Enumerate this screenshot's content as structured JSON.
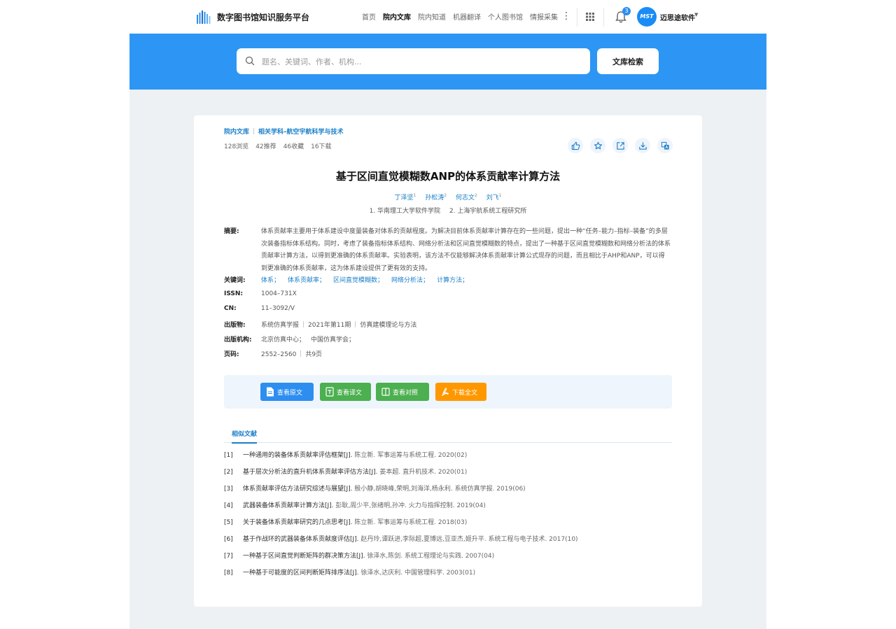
{
  "header": {
    "logo_text": "数字图书馆知识服务平台",
    "nav": [
      "首页",
      "院内文库",
      "院内知道",
      "机器翻译",
      "个人图书馆",
      "情报采集"
    ],
    "active_nav": "院内文库",
    "notification_count": "3",
    "avatar_text": "MST",
    "user_name": "迈思途软件"
  },
  "search": {
    "placeholder": "题名、关键词、作者、机构...",
    "button_label": "文库检索"
  },
  "breadcrumb": [
    "院内文库",
    "相关学科–航空宇航科学与技术"
  ],
  "stats": [
    "128浏览",
    "42推荐",
    "46收藏",
    "16下载"
  ],
  "actions": [
    "like-icon",
    "star-icon",
    "share-icon",
    "download-icon",
    "translate-icon"
  ],
  "article": {
    "title": "基于区间直觉模糊数ANP的体系贡献率计算方法",
    "authors": [
      {
        "name": "丁泽坚",
        "sup": "1"
      },
      {
        "name": "孙松涛",
        "sup": "2"
      },
      {
        "name": "何志文",
        "sup": "2"
      },
      {
        "name": "刘飞",
        "sup": "1"
      }
    ],
    "affiliations": [
      "1. 华南理工大学软件学院",
      "2. 上海宇航系统工程研究所"
    ]
  },
  "meta": {
    "abstract_label": "摘要:",
    "abstract": "体系贡献率主要用于体系建设中度量装备对体系的贡献程度。为解决目前体系贡献率计算存在的一些问题，提出一种“任务–能力–指标–装备”的多层次装备指标体系结构。同时，考虑了装备指标体系结构、网络分析法和区间直觉模糊数的特点，提出了一种基于区间直觉模糊数和网络分析法的体系贡献率计算方法，以得到更准确的体系贡献率。实验表明，该方法不仅能够解决体系贡献率计算公式现存的问题，而且相比于AHP和ANP，可以得到更准确的体系贡献率，这为体系建设提供了更有效的支持。",
    "keywords_label": "关键词:",
    "keywords": [
      "体系；",
      "体系贡献率；",
      "区间直觉模糊数；",
      "网络分析法；",
      "计算方法；"
    ],
    "issn_label": "ISSN:",
    "issn": "1004–731X",
    "cn_label": "CN:",
    "cn": "11–3092/V",
    "publication_label": "出版物:",
    "publication": [
      "系统仿真学报",
      "2021年第11期",
      "仿真建模理论与方法"
    ],
    "publisher_label": "出版机构:",
    "publishers": [
      "北京仿真中心；",
      "中国仿真学会；"
    ],
    "pages_label": "页码:",
    "pages": [
      "2552–2560",
      "共9页"
    ]
  },
  "buttons": [
    {
      "label": "查看原文",
      "color": "#2d8ef0"
    },
    {
      "label": "查看译文",
      "color": "#4caf50"
    },
    {
      "label": "查看对照",
      "color": "#4caf50"
    },
    {
      "label": "下载全文",
      "color": "#ff9800"
    }
  ],
  "similar": {
    "tab_label": "相似文献",
    "items": [
      {
        "idx": "[1]",
        "title": "一种通用的装备体系贡献率评估框架[J].",
        "rest": "陈立新.  军事运筹与系统工程.  2020(02)"
      },
      {
        "idx": "[2]",
        "title": "基于层次分析法的直升机体系贡献率评估方法[J].",
        "rest": "姜本超.  直升机技术.  2020(01)"
      },
      {
        "idx": "[3]",
        "title": "体系贡献率评估方法研究综述与展望[J].",
        "rest": "殷小静,胡晓峰,荣明,刘海洋,杨永利.  系统仿真学报.  2019(06)"
      },
      {
        "idx": "[4]",
        "title": "武器装备体系贡献率计算方法[J].",
        "rest": "彭耿,周少平,张绪明,孙冲.  火力与指挥控制.  2019(04)"
      },
      {
        "idx": "[5]",
        "title": "关于装备体系贡献率研究的几点思考[J].",
        "rest": "陈立新.  军事运筹与系统工程.  2018(03)"
      },
      {
        "idx": "[6]",
        "title": "基于作战环的武器装备体系贡献度评估[J].",
        "rest": "赵丹玲,谭跃进,李际超,夏博远,豆亚杰,姬升平.  系统工程与电子技术.  2017(10)"
      },
      {
        "idx": "[7]",
        "title": "一种基于区间直觉判断矩阵的群决策方法[J].",
        "rest": "徐泽水,陈剑.  系统工程理论与实践.  2007(04)"
      },
      {
        "idx": "[8]",
        "title": "一种基于可能度的区间判断矩阵排序法[J].",
        "rest": "徐泽水,达庆利.  中国管理科学.  2003(01)"
      }
    ]
  }
}
